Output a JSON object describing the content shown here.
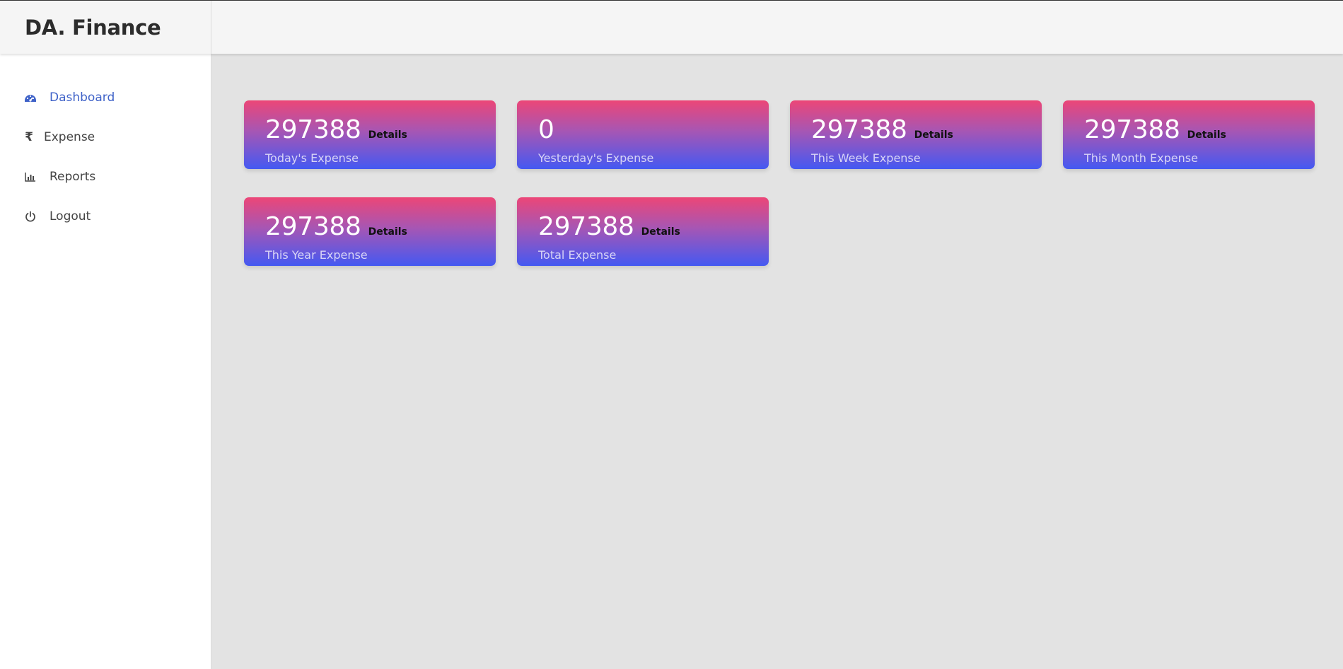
{
  "app": {
    "brand": "DA. Finance"
  },
  "sidebar": {
    "items": [
      {
        "label": "Dashboard",
        "icon": "dashboard-gauge-icon",
        "active": true
      },
      {
        "label": "Expense",
        "icon": "rupee-icon",
        "active": false
      },
      {
        "label": "Reports",
        "icon": "bar-chart-icon",
        "active": false
      },
      {
        "label": "Logout",
        "icon": "power-icon",
        "active": false
      }
    ]
  },
  "colors": {
    "accent": "#3f62c8",
    "card_gradient_top": "#ec4677",
    "card_gradient_bottom": "#4459f2"
  },
  "cards": [
    {
      "value": "297388",
      "details": "Details",
      "label": "Today's Expense"
    },
    {
      "value": "0",
      "details": "",
      "label": "Yesterday's Expense"
    },
    {
      "value": "297388",
      "details": "Details",
      "label": "This Week Expense"
    },
    {
      "value": "297388",
      "details": "Details",
      "label": "This Month Expense"
    },
    {
      "value": "297388",
      "details": "Details",
      "label": "This Year Expense"
    },
    {
      "value": "297388",
      "details": "Details",
      "label": "Total Expense"
    }
  ]
}
